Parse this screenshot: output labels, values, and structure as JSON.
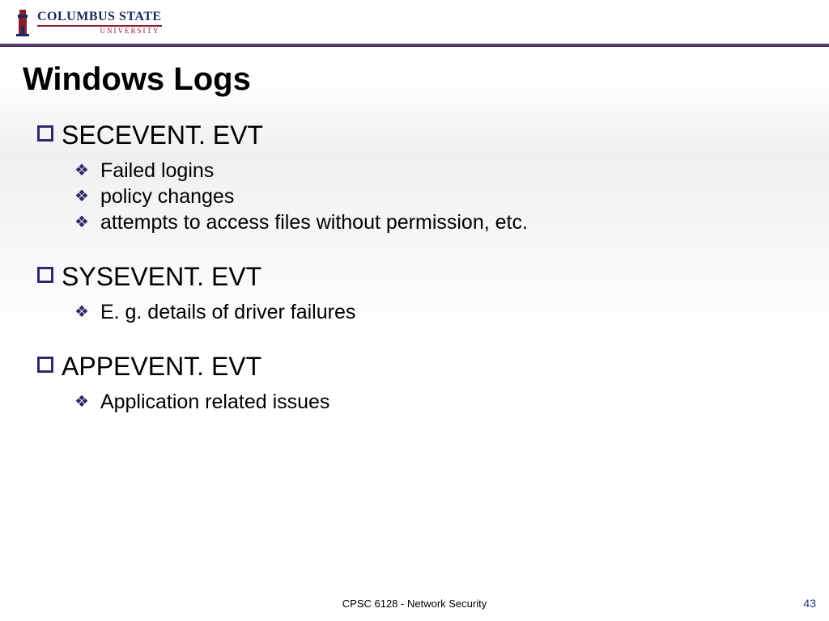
{
  "logo": {
    "line1": "COLUMBUS STATE",
    "line2": "UNIVERSITY"
  },
  "title": "Windows Logs",
  "sections": [
    {
      "heading": "SECEVENT. EVT",
      "items": [
        "Failed logins",
        "policy changes",
        "attempts to access files without permission, etc."
      ]
    },
    {
      "heading": "SYSEVENT. EVT",
      "items": [
        "E. g. details of driver failures"
      ]
    },
    {
      "heading": "APPEVENT. EVT",
      "items": [
        "Application related issues"
      ]
    }
  ],
  "footer": {
    "course": "CPSC 6128 - Network Security",
    "page": "43"
  }
}
